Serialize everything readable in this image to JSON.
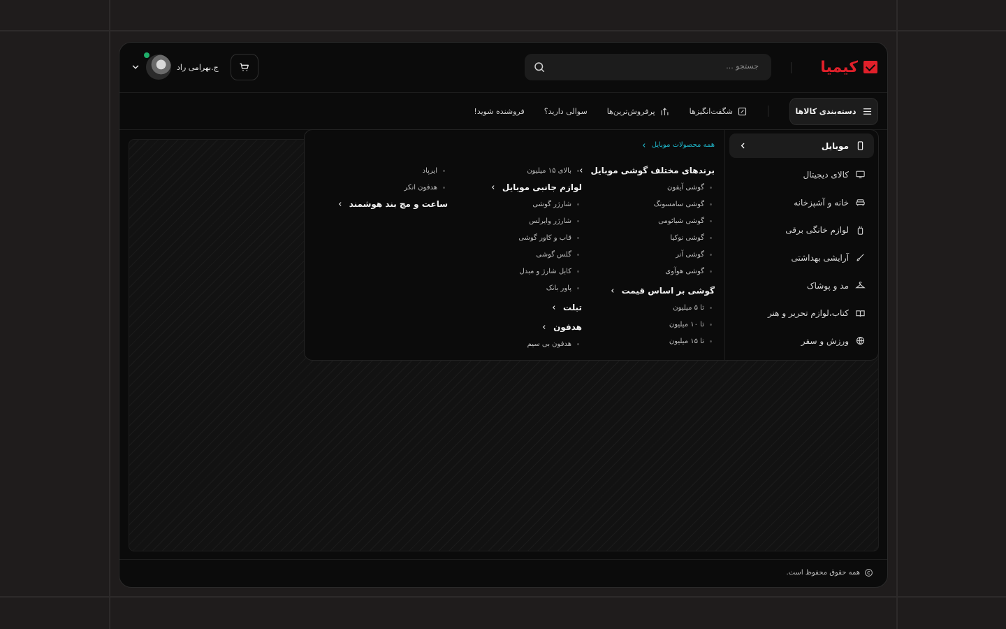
{
  "brand": {
    "name": "کیمیا",
    "accent": "#e0202a"
  },
  "header": {
    "search_placeholder": "جستجو ...",
    "user_name": "ج.بهرامی راد",
    "online_color": "#1fae6a"
  },
  "navbar": {
    "categories_button": "دسته‌بندی کالاها",
    "links": [
      "شگفت‌انگیزها",
      "پرفروش‌ترین‌ها",
      "سوالی دارید؟",
      "فروشنده شوید!"
    ]
  },
  "sidebar": {
    "items": [
      {
        "label": "موبایل",
        "icon": "mobile-icon",
        "active": true
      },
      {
        "label": "کالای دیجیتال",
        "icon": "monitor-icon"
      },
      {
        "label": "خانه و آشپزخانه",
        "icon": "sofa-icon"
      },
      {
        "label": "لوازم خانگی برقی",
        "icon": "appliance-icon"
      },
      {
        "label": "آرایشی بهداشتی",
        "icon": "brush-icon"
      },
      {
        "label": "مد و پوشاک",
        "icon": "hanger-icon"
      },
      {
        "label": "کتاب،لوازم تحریر و هنر",
        "icon": "book-icon"
      },
      {
        "label": "ورزش و سفر",
        "icon": "ball-icon"
      }
    ]
  },
  "megamenu": {
    "all_link": "همه محصولات موبایل",
    "col1": {
      "g1": {
        "title": "برندهای مختلف گوشی موبایل",
        "items": [
          "گوشی آیفون",
          "گوشی سامسونگ",
          "گوشی شیائومی",
          "گوشی نوکیا",
          "گوشی آنر",
          "گوشی هوآوی"
        ]
      },
      "g2": {
        "title": "گوشی بر اساس قیمت",
        "items": [
          "تا ۵ میلیون",
          "تا ۱۰ میلیون",
          "تا ۱۵ میلیون"
        ]
      }
    },
    "col2": {
      "top_item": "بالای ۱۵ میلیون",
      "g1": {
        "title": "لوازم جانبی موبایل",
        "items": [
          "شارژر گوشی",
          "شارژر وایرلس",
          "قاب و کاور گوشی",
          "گلس گوشی",
          "کابل شارژ و مبدل",
          "پاور بانک"
        ]
      },
      "g2": {
        "title": "تبلت"
      },
      "g3": {
        "title": "هدفون",
        "items": [
          "هدفون بی سیم"
        ]
      }
    },
    "col3": {
      "items": [
        "ایرپاد",
        "هدفون انکر"
      ],
      "g1": {
        "title": "ساعت و مچ بند هوشمند"
      }
    }
  },
  "footer": {
    "copyright": "همه حقوق محفوظ است."
  }
}
